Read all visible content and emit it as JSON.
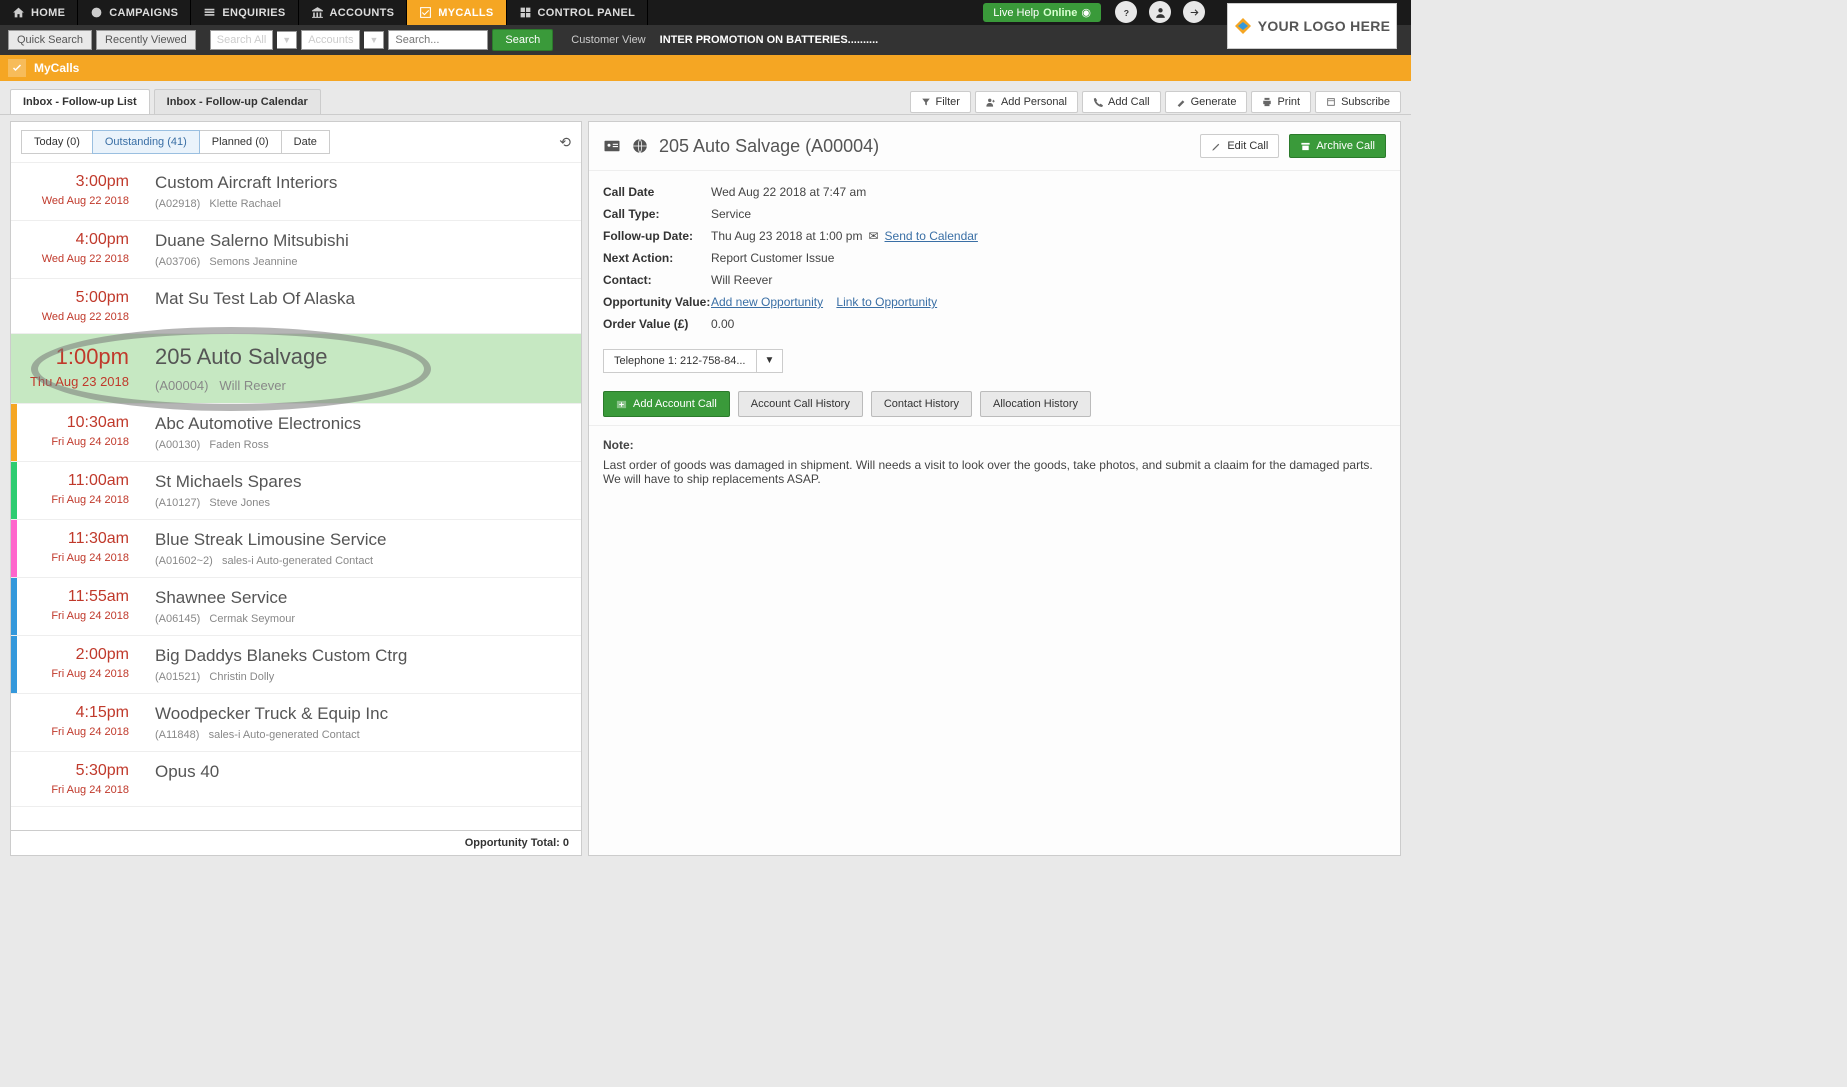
{
  "nav": {
    "items": [
      {
        "label": "HOME"
      },
      {
        "label": "CAMPAIGNS"
      },
      {
        "label": "ENQUIRIES"
      },
      {
        "label": "ACCOUNTS"
      },
      {
        "label": "MYCALLS"
      },
      {
        "label": "CONTROL PANEL"
      }
    ],
    "live_help": "Live Help",
    "live_status": "Online",
    "logo_text": "YOUR LOGO HERE"
  },
  "search": {
    "quick": "Quick Search",
    "recent": "Recently Viewed",
    "scope": "Search All",
    "entity": "Accounts",
    "placeholder": "Search...",
    "go": "Search",
    "cust_view": "Customer View",
    "promo": "INTER PROMOTION ON BATTERIES.........."
  },
  "orange": {
    "title": "MyCalls"
  },
  "tabs": {
    "list": "Inbox - Follow-up List",
    "calendar": "Inbox - Follow-up Calendar",
    "actions": [
      "Filter",
      "Add Personal",
      "Add Call",
      "Generate",
      "Print",
      "Subscribe"
    ]
  },
  "filter": {
    "today": "Today (0)",
    "outstanding": "Outstanding (41)",
    "planned": "Planned (0)",
    "date": "Date"
  },
  "calls": [
    {
      "time": "3:00pm",
      "date": "Wed Aug 22 2018",
      "name": "Custom Aircraft Interiors",
      "code": "(A02918)",
      "contact": "Klette Rachael",
      "stripe": ""
    },
    {
      "time": "4:00pm",
      "date": "Wed Aug 22 2018",
      "name": "Duane Salerno Mitsubishi",
      "code": "(A03706)",
      "contact": "Semons Jeannine",
      "stripe": ""
    },
    {
      "time": "5:00pm",
      "date": "Wed Aug 22 2018",
      "name": "Mat Su Test Lab Of Alaska",
      "code": "",
      "contact": "",
      "stripe": ""
    },
    {
      "time": "1:00pm",
      "date": "Thu Aug 23 2018",
      "name": "205 Auto Salvage",
      "code": "(A00004)",
      "contact": "Will Reever",
      "stripe": "",
      "selected": true
    },
    {
      "time": "10:30am",
      "date": "Fri Aug 24 2018",
      "name": "Abc Automotive Electronics",
      "code": "(A00130)",
      "contact": "Faden Ross",
      "stripe": "#f5a623"
    },
    {
      "time": "11:00am",
      "date": "Fri Aug 24 2018",
      "name": "St Michaels Spares",
      "code": "(A10127)",
      "contact": "Steve Jones",
      "stripe": "#2ecc71"
    },
    {
      "time": "11:30am",
      "date": "Fri Aug 24 2018",
      "name": "Blue Streak Limousine Service",
      "code": "(A01602~2)",
      "contact": "sales-i Auto-generated Contact",
      "stripe": "#ff66cc"
    },
    {
      "time": "11:55am",
      "date": "Fri Aug 24 2018",
      "name": "Shawnee Service",
      "code": "(A06145)",
      "contact": "Cermak Seymour",
      "stripe": "#3498db"
    },
    {
      "time": "2:00pm",
      "date": "Fri Aug 24 2018",
      "name": "Big Daddys Blaneks Custom Ctrg",
      "code": "(A01521)",
      "contact": "Christin Dolly",
      "stripe": "#3498db"
    },
    {
      "time": "4:15pm",
      "date": "Fri Aug 24 2018",
      "name": "Woodpecker Truck & Equip Inc",
      "code": "(A11848)",
      "contact": "sales-i Auto-generated Contact",
      "stripe": ""
    },
    {
      "time": "5:30pm",
      "date": "Fri Aug 24 2018",
      "name": "Opus 40",
      "code": "",
      "contact": "",
      "stripe": ""
    }
  ],
  "opp_total": "Opportunity Total:  0",
  "detail": {
    "title": "205 Auto Salvage (A00004)",
    "edit": "Edit Call",
    "archive": "Archive Call",
    "fields": {
      "call_date_k": "Call Date",
      "call_date_v": "Wed Aug 22 2018 at 7:47 am",
      "call_type_k": "Call Type:",
      "call_type_v": "Service",
      "followup_k": "Follow-up Date:",
      "followup_v": "Thu Aug 23 2018 at 1:00 pm",
      "followup_link": "Send to Calendar",
      "next_k": "Next Action:",
      "next_v": "Report Customer Issue",
      "contact_k": "Contact:",
      "contact_v": "Will Reever",
      "oppval_k": "Opportunity Value:",
      "oppval_add": "Add new Opportunity",
      "oppval_link": "Link to Opportunity",
      "order_k": "Order Value (£)",
      "order_v": "0.00"
    },
    "phone": "Telephone 1: 212-758-84...",
    "btns": {
      "add_account": "Add Account Call",
      "acct_hist": "Account Call History",
      "contact_hist": "Contact History",
      "alloc_hist": "Allocation History"
    },
    "note_head": "Note:",
    "note_body": "Last order of goods was damaged in shipment. Will needs a visit to look over the goods, take photos, and submit a claaim for the damaged parts. We will have to ship replacements ASAP."
  }
}
